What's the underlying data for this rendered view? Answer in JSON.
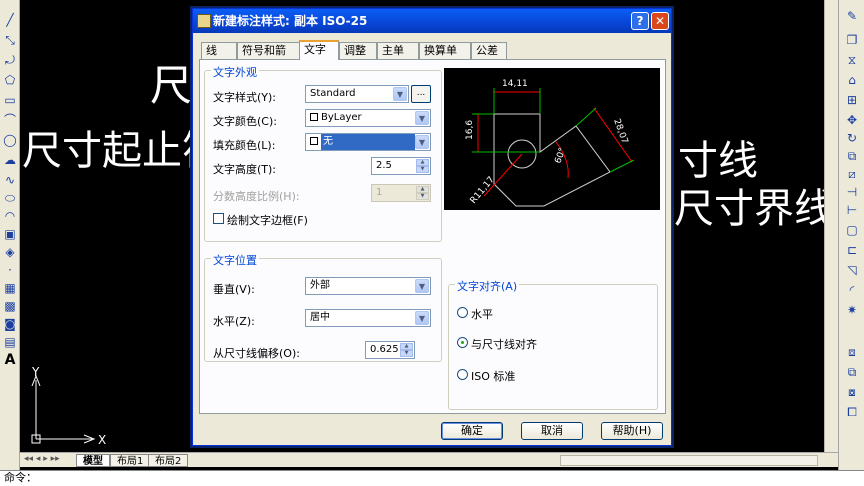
{
  "canvas": {
    "texts": [
      "尺",
      "尺寸起止符",
      "寸线",
      "尺寸界线"
    ],
    "axis_labels": {
      "x": "X",
      "y": "Y"
    }
  },
  "layout_tabs": [
    "模型",
    "布局1",
    "布局2"
  ],
  "command_line": "命令：",
  "dialog": {
    "title": "新建标注样式: 副本 ISO-25",
    "help_button": "?",
    "close_button": "✕",
    "tabs": [
      "线",
      "符号和箭头",
      "文字",
      "调整",
      "主单位",
      "换算单位",
      "公差"
    ],
    "active_tab": "文字",
    "text_appearance": {
      "group_title": "文字外观",
      "text_style_label": "文字样式(Y):",
      "text_style_value": "Standard",
      "browse_label": "...",
      "text_color_label": "文字颜色(C):",
      "text_color_value": "ByLayer",
      "fill_color_label": "填充颜色(L):",
      "fill_color_value": "无",
      "text_height_label": "文字高度(T):",
      "text_height_value": "2.5",
      "fraction_scale_label": "分数高度比例(H):",
      "fraction_scale_value": "1",
      "draw_frame_label": "绘制文字边框(F)"
    },
    "preview": {
      "dims": [
        "14,11",
        "16,6",
        "28,07",
        "60°",
        "R11,17"
      ]
    },
    "text_placement": {
      "group_title": "文字位置",
      "vertical_label": "垂直(V):",
      "vertical_value": "外部",
      "horizontal_label": "水平(Z):",
      "horizontal_value": "居中",
      "offset_label": "从尺寸线偏移(O):",
      "offset_value": "0.625"
    },
    "text_alignment": {
      "group_title": "文字对齐(A)",
      "options": [
        "水平",
        "与尺寸线对齐",
        "ISO 标准"
      ],
      "selected_index": 1
    },
    "buttons": {
      "ok": "确定",
      "cancel": "取消",
      "help": "帮助(H)"
    }
  },
  "colors": {
    "titlebar": "#0845d6",
    "group_title": "#0046d5",
    "preview_dim_green": "#00c000",
    "preview_geometry_yellow": "#ffff00",
    "preview_dim_red": "#ff0000"
  }
}
